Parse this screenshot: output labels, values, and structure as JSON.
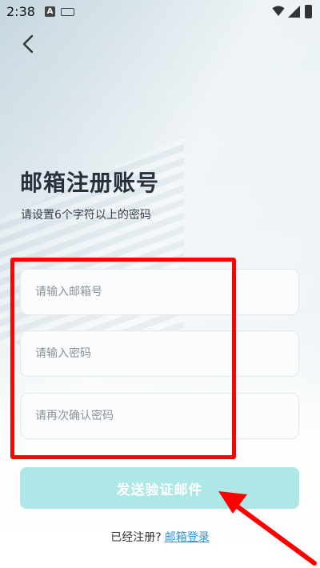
{
  "status_bar": {
    "time": "2:38",
    "icons": [
      "a-notification-icon",
      "keyboard-icon",
      "wifi-icon",
      "signal-icon",
      "battery-icon"
    ]
  },
  "header": {
    "back_icon": "chevron-left-icon"
  },
  "page": {
    "title": "邮箱注册账号",
    "subtitle": "请设置6个字符以上的密码"
  },
  "form": {
    "email_placeholder": "请输入邮箱号",
    "password_placeholder": "请输入密码",
    "confirm_placeholder": "请再次确认密码",
    "submit_label": "发送验证邮件"
  },
  "footer": {
    "prompt": "已经注册?",
    "login_link": "邮箱登录"
  },
  "colors": {
    "title": "#2a2f3d",
    "submit_bg": "#ade8e6",
    "link": "#2d92d8",
    "annotation": "#ff0000"
  }
}
